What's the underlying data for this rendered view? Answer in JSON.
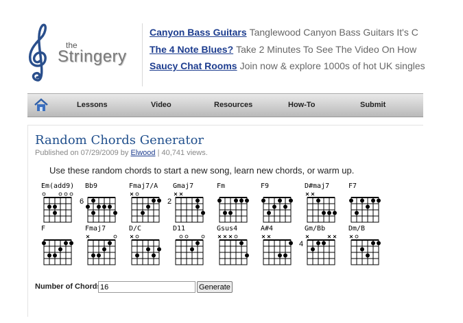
{
  "logo": {
    "the": "the",
    "name": "Stringery"
  },
  "ads": [
    {
      "link": "Canyon Bass Guitars",
      "desc": "Tanglewood Canyon Bass Guitars It's C"
    },
    {
      "link": "The 4 Note Blues?",
      "desc": "Take 2 Minutes To See The Video On How"
    },
    {
      "link": "Saucy Chat Rooms",
      "desc": "Join now & explore 1000s of hot UK singles"
    }
  ],
  "nav": [
    "Lessons",
    "Video",
    "Resources",
    "How-To",
    "Submit"
  ],
  "article": {
    "title": "Random Chords Generator",
    "meta_prefix": "Published on 07/29/2009 by",
    "author": "Elwood",
    "meta_suffix": "| 40,741 views.",
    "intro": "Use these random chords to start a new song, learn new chords, or warm up."
  },
  "chords": [
    {
      "name": "Em(add9)",
      "fret": "",
      "top": "o--ooo",
      "dots": [
        [
          2,
          2
        ],
        [
          3,
          2
        ],
        [
          2,
          1
        ]
      ]
    },
    {
      "name": "Bb9",
      "fret": "6",
      "top": "------",
      "dots": [
        [
          2,
          0
        ],
        [
          3,
          1
        ],
        [
          1,
          1
        ],
        [
          2,
          2
        ],
        [
          2,
          3
        ],
        [
          2,
          4
        ],
        [
          3,
          5
        ]
      ]
    },
    {
      "name": "Fmaj7/A",
      "fret": "",
      "top": "xo----",
      "dots": [
        [
          3,
          2
        ],
        [
          2,
          3
        ],
        [
          1,
          4
        ],
        [
          1,
          5
        ]
      ]
    },
    {
      "name": "Gmaj7",
      "fret": "2",
      "top": "xx----",
      "dots": [
        [
          1,
          4
        ],
        [
          2,
          4
        ],
        [
          3,
          5
        ]
      ]
    },
    {
      "name": "Fm",
      "fret": "",
      "top": "------",
      "dots": [
        [
          1,
          0
        ],
        [
          3,
          1
        ],
        [
          3,
          2
        ],
        [
          1,
          3
        ],
        [
          1,
          4
        ],
        [
          1,
          5
        ]
      ]
    },
    {
      "name": "F9",
      "fret": "",
      "top": "------",
      "dots": [
        [
          1,
          0
        ],
        [
          3,
          1
        ],
        [
          2,
          2
        ],
        [
          1,
          3
        ],
        [
          2,
          4
        ],
        [
          1,
          5
        ]
      ]
    },
    {
      "name": "D#maj7",
      "fret": "",
      "top": "xx----",
      "dots": [
        [
          1,
          2
        ],
        [
          3,
          3
        ],
        [
          3,
          4
        ],
        [
          3,
          5
        ]
      ]
    },
    {
      "name": "F7",
      "fret": "",
      "top": "------",
      "dots": [
        [
          1,
          0
        ],
        [
          3,
          1
        ],
        [
          1,
          2
        ],
        [
          2,
          3
        ],
        [
          1,
          4
        ],
        [
          1,
          5
        ]
      ]
    },
    {
      "name": "F",
      "fret": "",
      "top": "------",
      "dots": [
        [
          1,
          0
        ],
        [
          3,
          1
        ],
        [
          3,
          2
        ],
        [
          2,
          3
        ],
        [
          1,
          4
        ],
        [
          1,
          5
        ]
      ]
    },
    {
      "name": "Fmaj7",
      "fret": "",
      "top": "x----o",
      "dots": [
        [
          3,
          1
        ],
        [
          3,
          2
        ],
        [
          2,
          3
        ],
        [
          1,
          4
        ]
      ]
    },
    {
      "name": "D/C",
      "fret": "",
      "top": "xo----",
      "dots": [
        [
          3,
          1
        ],
        [
          2,
          3
        ],
        [
          3,
          4
        ],
        [
          2,
          5
        ]
      ]
    },
    {
      "name": "D11",
      "fret": "",
      "top": "-oo--o",
      "dots": [
        [
          2,
          3
        ],
        [
          1,
          4
        ]
      ]
    },
    {
      "name": "Gsus4",
      "fret": "",
      "top": "xxxo--",
      "dots": [
        [
          1,
          4
        ],
        [
          3,
          5
        ]
      ]
    },
    {
      "name": "A#4",
      "fret": "",
      "top": "xx----",
      "dots": [
        [
          3,
          3
        ],
        [
          3,
          4
        ],
        [
          1,
          5
        ]
      ]
    },
    {
      "name": "Gm/Bb",
      "fret": "4",
      "top": "x---xx",
      "dots": [
        [
          2,
          1
        ],
        [
          1,
          2
        ],
        [
          1,
          3
        ]
      ]
    },
    {
      "name": "Dm/B",
      "fret": "",
      "top": "xo----",
      "dots": [
        [
          2,
          2
        ],
        [
          3,
          3
        ],
        [
          1,
          4
        ],
        [
          1,
          5
        ]
      ]
    }
  ],
  "form": {
    "label": "Number of Chords",
    "value": "16",
    "button": "Generate"
  }
}
